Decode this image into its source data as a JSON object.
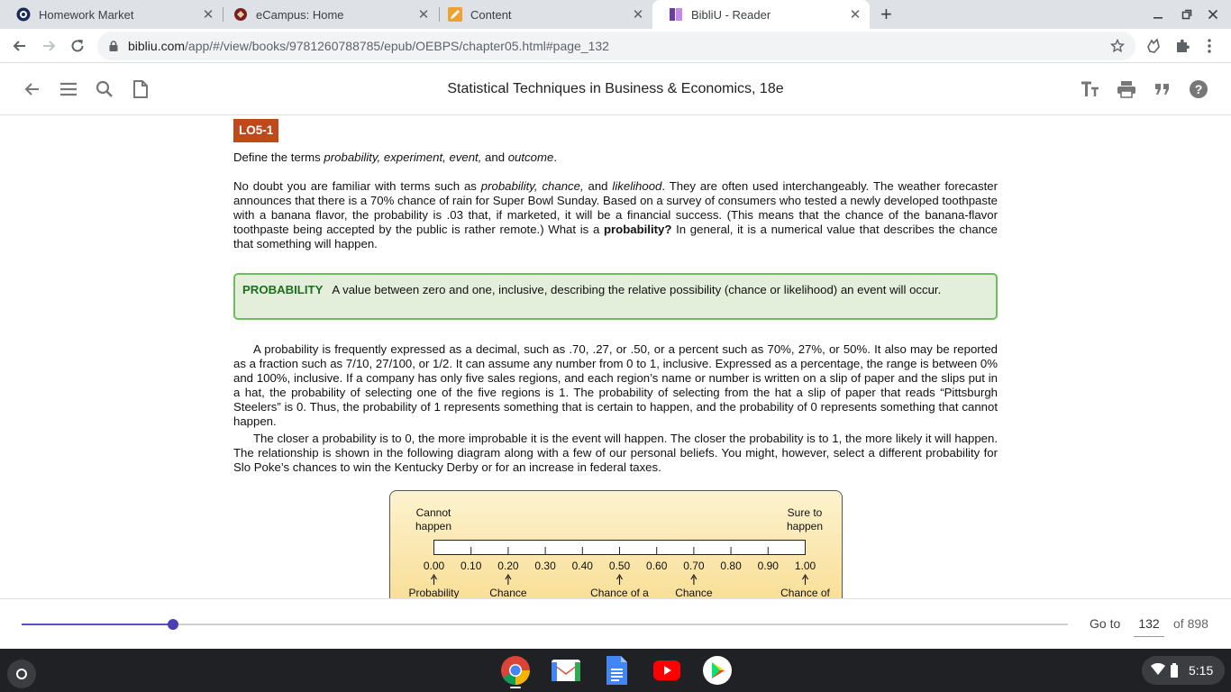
{
  "browser": {
    "tabs": [
      {
        "title": "Homework Market",
        "icon": "homework-market-favicon"
      },
      {
        "title": "eCampus: Home",
        "icon": "ecampus-favicon"
      },
      {
        "title": "Content",
        "icon": "pencil-favicon"
      },
      {
        "title": "BibliU - Reader",
        "icon": "bibliu-favicon",
        "active": true
      }
    ],
    "url_domain": "bibliu.com",
    "url_path": "/app/#/view/books/9781260788785/epub/OEBPS/chapter05.html#page_132"
  },
  "reader": {
    "book_title": "Statistical Techniques in Business & Economics, 18e",
    "progress_fraction": 0.145,
    "goto_label": "Go to",
    "page_number": "132",
    "total_pages_label": "of 898"
  },
  "content": {
    "lo_badge": "LO5-1",
    "objective_prefix": "Define the terms ",
    "objective_terms": "probability, experiment, event,",
    "objective_and": " and ",
    "objective_last": "outcome",
    "objective_end": ".",
    "p1_a": "No doubt you are familiar with terms such as ",
    "p1_italic": "probability, chance,",
    "p1_b": " and ",
    "p1_italic2": "likelihood",
    "p1_c": ". They are often used interchangeably. The weather forecaster announces that there is a 70% chance of rain for Super Bowl Sunday. Based on a survey of consumers who tested a newly developed toothpaste with a banana flavor, the probability is .03 that, if marketed, it will be a financial success. (This means that the chance of the banana-flavor toothpaste being accepted by the public is rather remote.) What is a ",
    "p1_bold": "probability?",
    "p1_d": " In general, it is a numerical value that describes the chance that something will happen.",
    "def_term": "PROBABILITY",
    "def_text": "A value between zero and one, inclusive, describing the relative possibility (chance or likelihood) an event will occur.",
    "p2": "A probability is frequently expressed as a decimal, such as .70, .27, or .50, or a percent such as 70%, 27%, or 50%. It also may be reported as a fraction such as 7/10, 27/100, or 1/2. It can assume any number from 0 to 1, inclusive. Expressed as a percentage, the range is between 0% and 100%, inclusive. If a company has only five sales regions, and each region’s name or number is written on a slip of paper and the slips put in a hat, the probability of selecting one of the five regions is 1. The probability of selecting from the hat a slip of paper that reads “Pittsburgh Steelers” is 0. Thus, the probability of 1 represents something that is certain to happen, and the probability of 0 represents something that cannot happen.",
    "p3": "The closer a probability is to 0, the more improbable it is the event will happen. The closer the probability is to 1, the more likely it will happen. The relationship is shown in the following diagram along with a few of our personal beliefs. You might, however, select a different probability for Slo Poke’s chances to win the Kentucky Derby or for an increase in federal taxes."
  },
  "diagram": {
    "left_label_1": "Cannot",
    "left_label_2": "happen",
    "right_label_1": "Sure to",
    "right_label_2": "happen",
    "ticks": [
      "0.00",
      "0.10",
      "0.20",
      "0.30",
      "0.40",
      "0.50",
      "0.60",
      "0.70",
      "0.80",
      "0.90",
      "1.00"
    ],
    "arrow_labels": [
      {
        "value": "0.00",
        "text": "Probability"
      },
      {
        "value": "0.20",
        "text": "Chance"
      },
      {
        "value": "0.50",
        "text": "Chance of a"
      },
      {
        "value": "0.70",
        "text": "Chance"
      },
      {
        "value": "1.00",
        "text": "Chance of"
      }
    ]
  },
  "shelf": {
    "apps": [
      "chrome-icon",
      "gmail-icon",
      "docs-icon",
      "youtube-icon",
      "play-store-icon"
    ],
    "time": "5:15"
  }
}
